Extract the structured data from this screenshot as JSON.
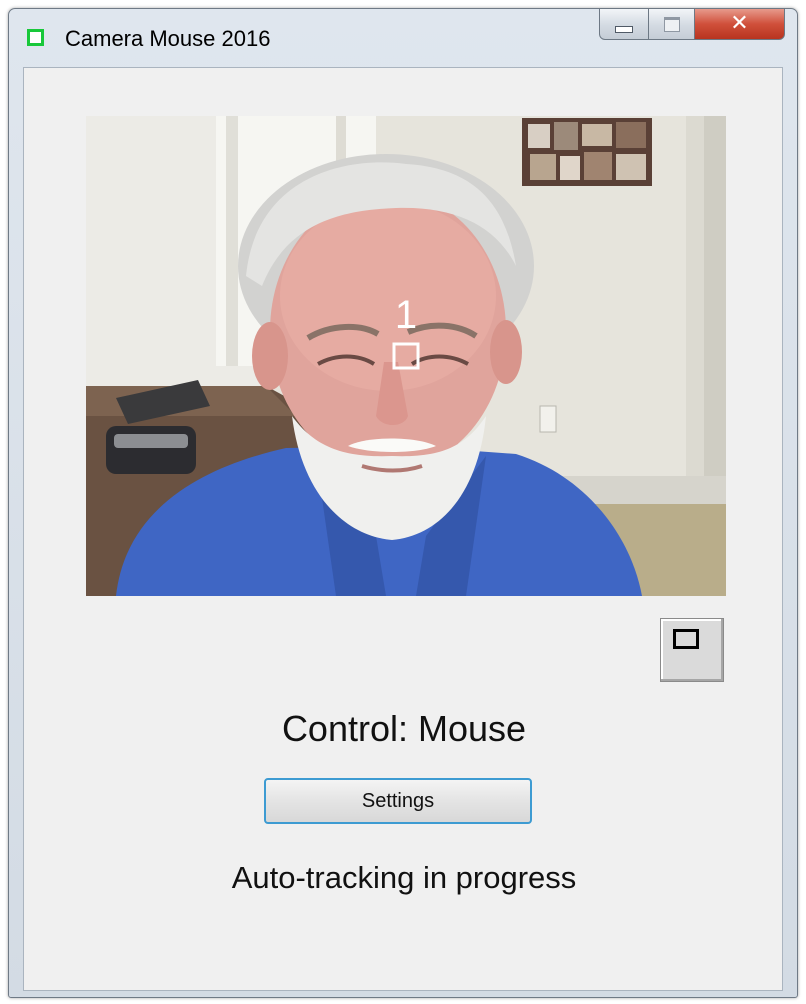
{
  "window": {
    "title": "Camera Mouse 2016",
    "controls": {
      "minimize": "minimize-icon",
      "maximize": "maximize-icon",
      "close": "✕"
    }
  },
  "video": {
    "tracking_point_label": "1",
    "tracker_color": "#ffffff"
  },
  "main": {
    "control_label": "Control: Mouse",
    "settings_label": "Settings",
    "status_text": "Auto-tracking in progress"
  },
  "colors": {
    "app_icon": "#18c83a",
    "close_button": "#c9452f",
    "settings_focus_border": "#3d9bd2"
  }
}
